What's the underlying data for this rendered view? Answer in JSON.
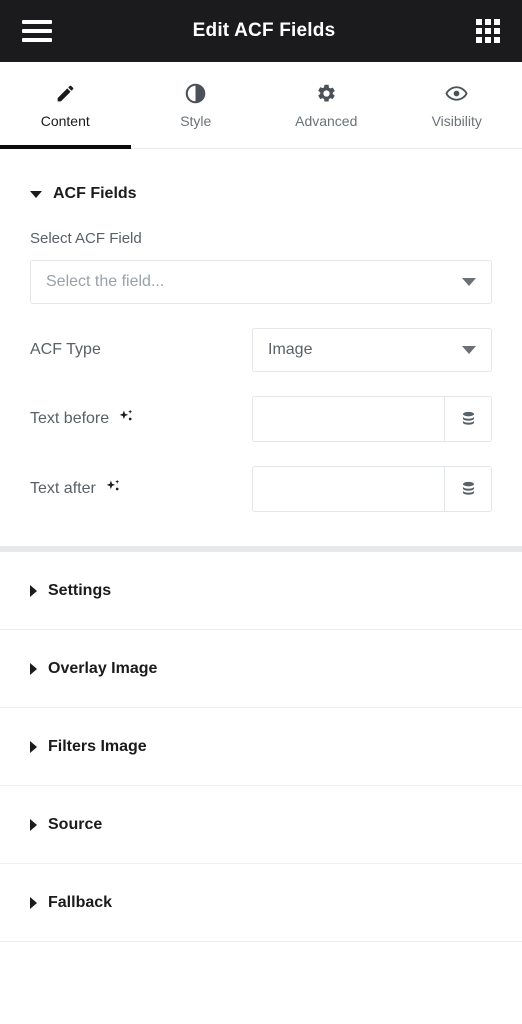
{
  "header": {
    "title": "Edit ACF Fields",
    "menu_icon": "hamburger-menu-icon",
    "apps_icon": "grid-apps-icon"
  },
  "tabs": [
    {
      "label": "Content",
      "icon": "pencil-icon",
      "active": true
    },
    {
      "label": "Style",
      "icon": "contrast-icon",
      "active": false
    },
    {
      "label": "Advanced",
      "icon": "gear-icon",
      "active": false
    },
    {
      "label": "Visibility",
      "icon": "eye-icon",
      "active": false
    }
  ],
  "open_section": {
    "title": "ACF Fields",
    "expanded": true,
    "select_field": {
      "label": "Select ACF Field",
      "value": "",
      "placeholder": "Select the field..."
    },
    "acf_type": {
      "label": "ACF Type",
      "value": "Image"
    },
    "text_before": {
      "label": "Text before",
      "value": "",
      "placeholder": "",
      "ai_icon": "sparkle-ai-icon",
      "dynamic_icon": "database-stack-icon"
    },
    "text_after": {
      "label": "Text after",
      "value": "",
      "placeholder": "",
      "ai_icon": "sparkle-ai-icon",
      "dynamic_icon": "database-stack-icon"
    }
  },
  "collapsed_sections": [
    {
      "label": "Settings"
    },
    {
      "label": "Overlay Image"
    },
    {
      "label": "Filters Image"
    },
    {
      "label": "Source"
    },
    {
      "label": "Fallback"
    }
  ],
  "colors": {
    "header_bg": "#1b1b1d",
    "accent_underline": "#0b0b0d",
    "text_primary": "#1b1b1d",
    "text_secondary": "#5a6067",
    "placeholder": "#9aa1a9",
    "border": "#e3e6e9",
    "divider": "#e7e8ea"
  }
}
